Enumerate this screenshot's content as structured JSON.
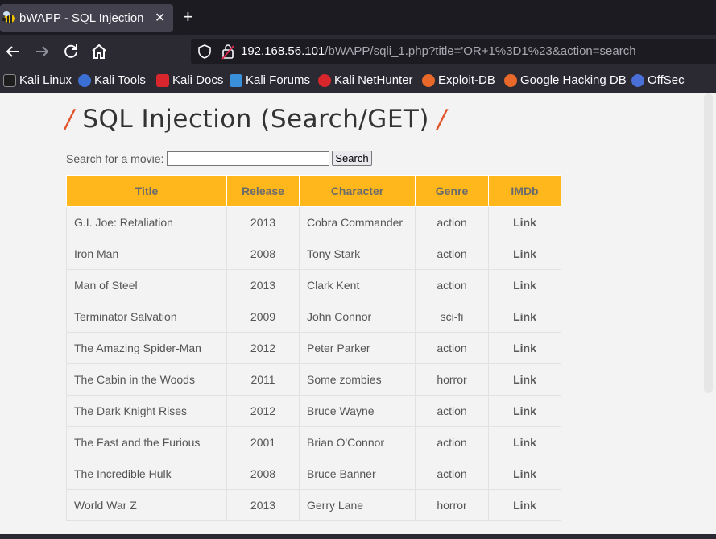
{
  "browser": {
    "tab_title": "bWAPP - SQL Injection",
    "tab_close": "✕",
    "new_tab": "+",
    "url_host": "192.168.56.101",
    "url_path": "/bWAPP/sqli_1.php?title='OR+1%3D1%23&action=search"
  },
  "bookmarks": [
    {
      "label": "Kali Linux",
      "color": "#1e1e1e"
    },
    {
      "label": "Kali Tools",
      "color": "#3b6fd4"
    },
    {
      "label": "Kali Docs",
      "color": "#d9262c"
    },
    {
      "label": "Kali Forums",
      "color": "#3a8fd9"
    },
    {
      "label": "Kali NetHunter",
      "color": "#d9262c"
    },
    {
      "label": "Exploit-DB",
      "color": "#e8692a"
    },
    {
      "label": "Google Hacking DB",
      "color": "#e8692a"
    },
    {
      "label": "OffSec",
      "color": "#4a6fd8"
    }
  ],
  "page": {
    "title_slash": "/",
    "title": "SQL Injection (Search/GET)",
    "search_label": "Search for a movie:",
    "search_value": "",
    "search_button": "Search"
  },
  "table": {
    "headers": [
      "Title",
      "Release",
      "Character",
      "Genre",
      "IMDb"
    ],
    "rows": [
      [
        "G.I. Joe: Retaliation",
        "2013",
        "Cobra Commander",
        "action",
        "Link"
      ],
      [
        "Iron Man",
        "2008",
        "Tony Stark",
        "action",
        "Link"
      ],
      [
        "Man of Steel",
        "2013",
        "Clark Kent",
        "action",
        "Link"
      ],
      [
        "Terminator Salvation",
        "2009",
        "John Connor",
        "sci-fi",
        "Link"
      ],
      [
        "The Amazing Spider-Man",
        "2012",
        "Peter Parker",
        "action",
        "Link"
      ],
      [
        "The Cabin in the Woods",
        "2011",
        "Some zombies",
        "horror",
        "Link"
      ],
      [
        "The Dark Knight Rises",
        "2012",
        "Bruce Wayne",
        "action",
        "Link"
      ],
      [
        "The Fast and the Furious",
        "2001",
        "Brian O'Connor",
        "action",
        "Link"
      ],
      [
        "The Incredible Hulk",
        "2008",
        "Bruce Banner",
        "action",
        "Link"
      ],
      [
        "World War Z",
        "2013",
        "Gerry Lane",
        "horror",
        "Link"
      ]
    ]
  }
}
